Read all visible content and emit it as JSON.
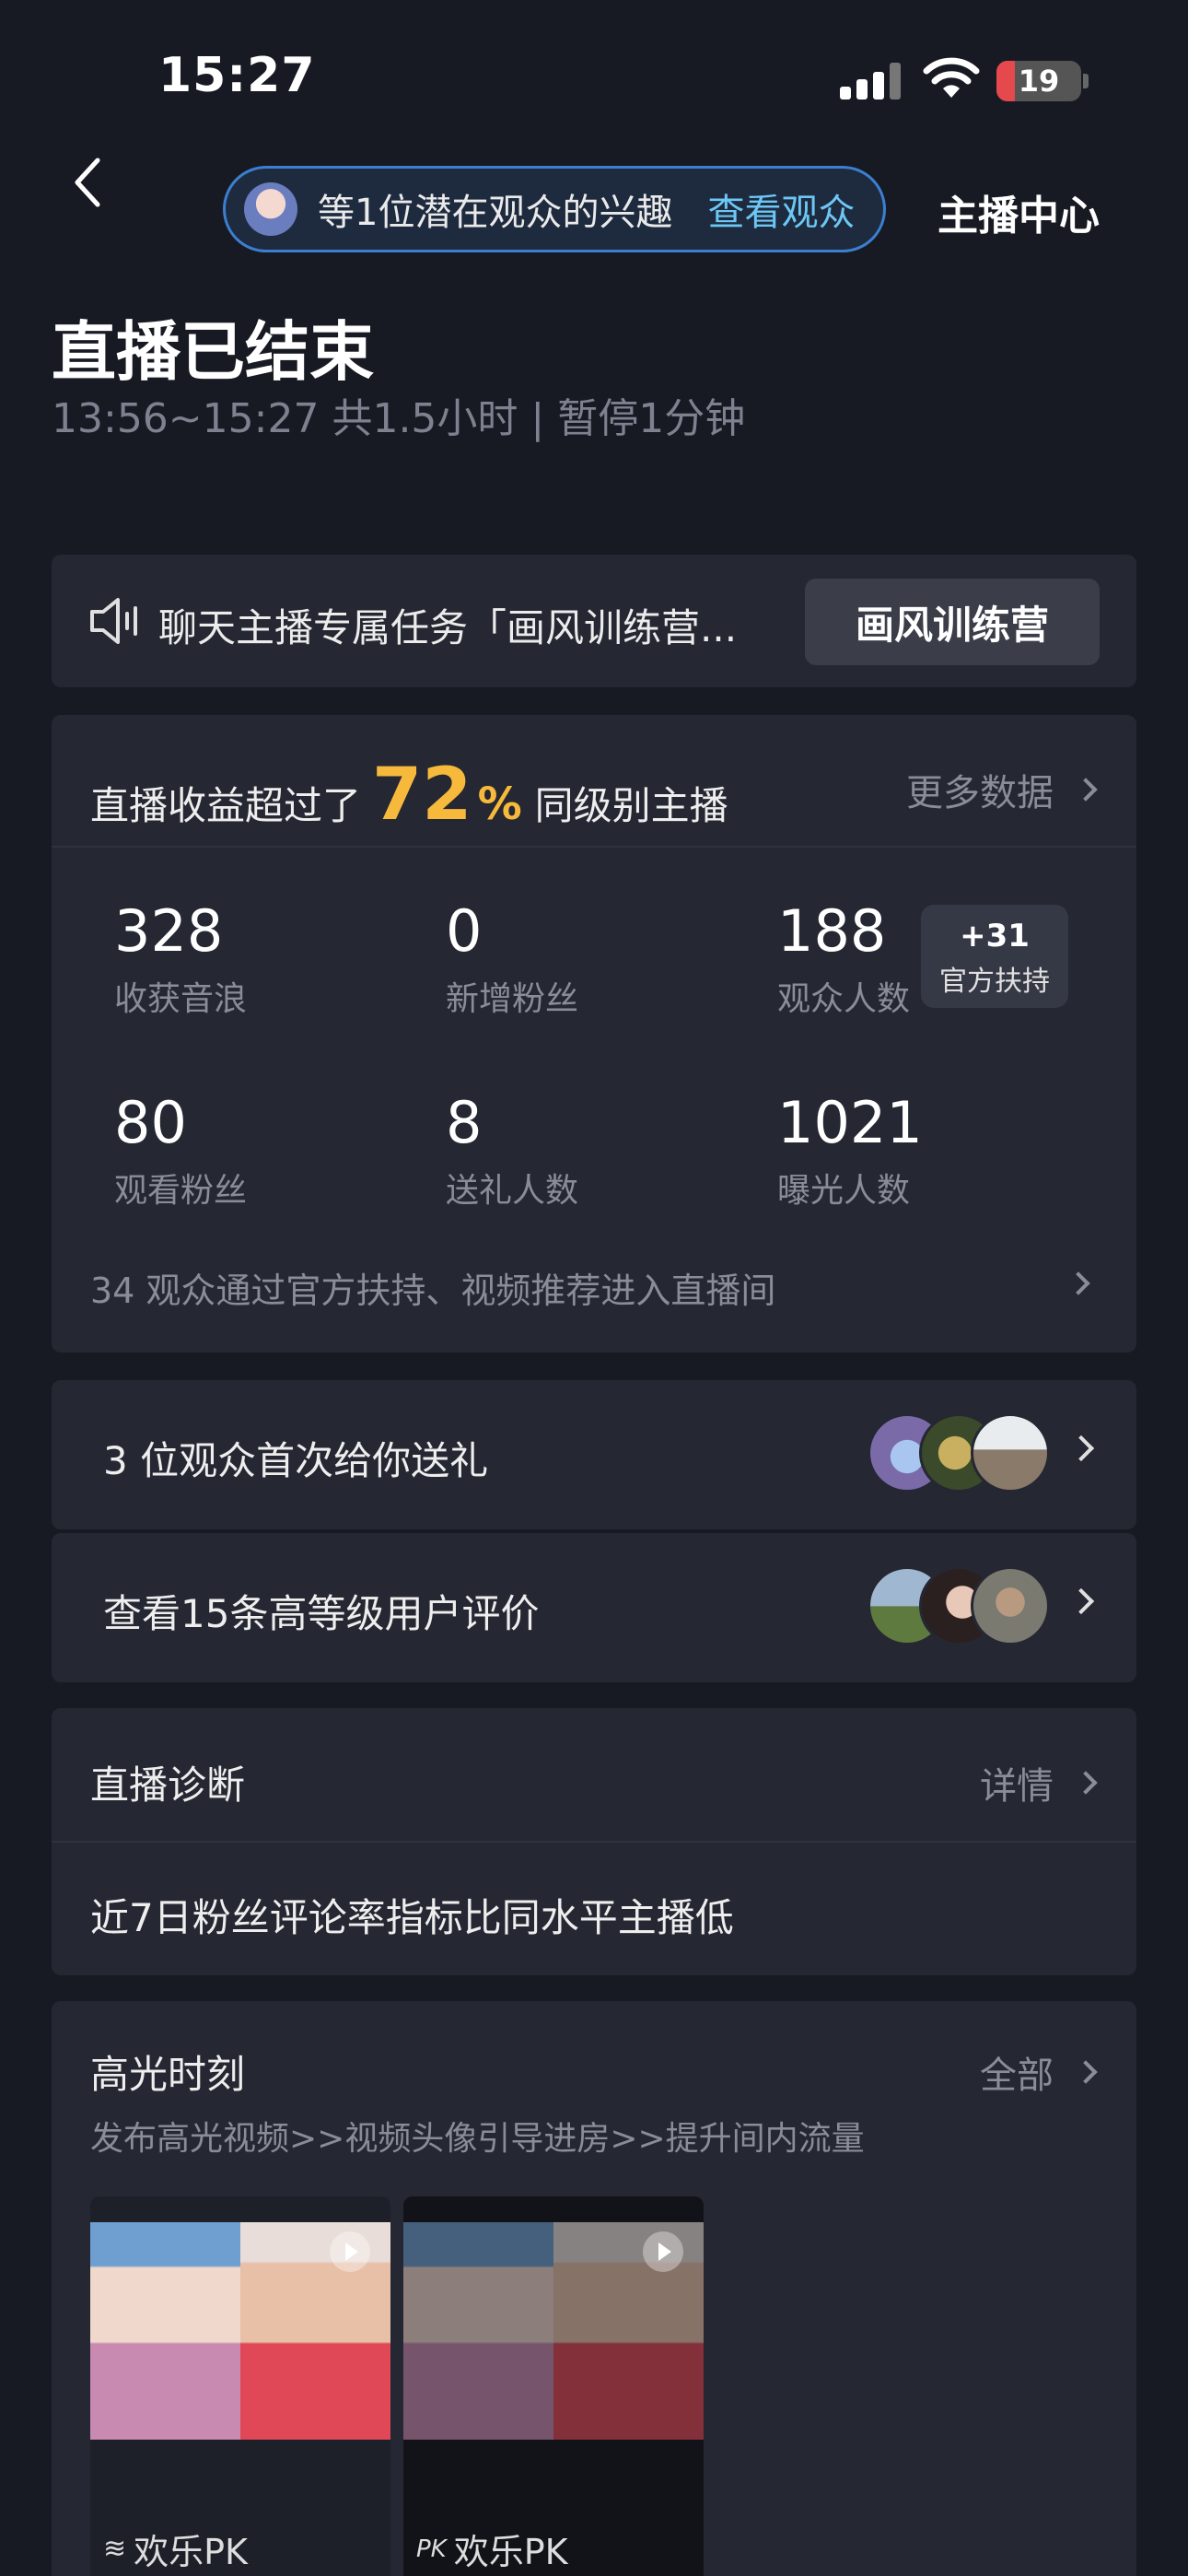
{
  "status_bar": {
    "time": "15:27",
    "battery": "19"
  },
  "nav": {
    "banner_text": "等1位潜在观众的兴趣",
    "banner_link": "查看观众",
    "right_label": "主播中心"
  },
  "header": {
    "title": "直播已结束",
    "subtitle": "13:56~15:27 共1.5小时 | 暂停1分钟"
  },
  "task": {
    "text": "聊天主播专属任务「画风训练营...",
    "button": "画风训练营"
  },
  "stats": {
    "rev_prefix": "直播收益超过了",
    "rev_pct": "72",
    "rev_pct_sign": "%",
    "rev_suffix": "同级别主播",
    "more": "更多数据",
    "items": [
      {
        "value": "328",
        "label": "收获音浪"
      },
      {
        "value": "0",
        "label": "新增粉丝"
      },
      {
        "value": "188",
        "label": "观众人数"
      },
      {
        "value": "80",
        "label": "观看粉丝"
      },
      {
        "value": "8",
        "label": "送礼人数"
      },
      {
        "value": "1021",
        "label": "曝光人数"
      }
    ],
    "badge_value": "+31",
    "badge_label": "官方扶持",
    "footnote": "34 观众通过官方扶持、视频推荐进入直播间"
  },
  "gifts": {
    "text": "3 位观众首次给你送礼"
  },
  "evaluations": {
    "text": "查看15条高等级用户评价"
  },
  "diagnosis": {
    "title": "直播诊断",
    "more": "详情",
    "text": "近7日粉丝评论率指标比同水平主播低"
  },
  "highlights": {
    "title": "高光时刻",
    "more": "全部",
    "subtitle": "发布高光视频>>视频头像引导进房>>提升间内流量",
    "clips": [
      {
        "caption": "欢乐PK",
        "icon": "layers-icon"
      },
      {
        "caption": "欢乐PK",
        "icon": "pk-icon"
      }
    ]
  },
  "colors": {
    "background": "#181a23",
    "card": "#252732",
    "accent_gold": "#f6b93b",
    "link_blue": "#6cc7f5",
    "battery_red": "#e5484d"
  }
}
